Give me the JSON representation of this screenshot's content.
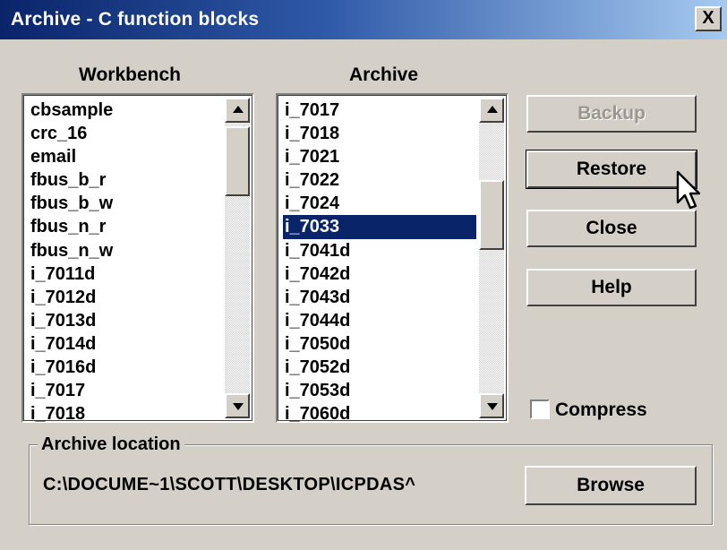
{
  "window": {
    "title": "Archive - C function blocks",
    "close_label": "X"
  },
  "workbench": {
    "heading": "Workbench",
    "items": [
      "cbsample",
      "crc_16",
      "email",
      "fbus_b_r",
      "fbus_b_w",
      "fbus_n_r",
      "fbus_n_w",
      "i_7011d",
      "i_7012d",
      "i_7013d",
      "i_7014d",
      "i_7016d",
      "i_7017",
      "i_7018"
    ]
  },
  "archive": {
    "heading": "Archive",
    "items": [
      "i_7017",
      "i_7018",
      "i_7021",
      "i_7022",
      "i_7024",
      "i_7033",
      "i_7041d",
      "i_7042d",
      "i_7043d",
      "i_7044d",
      "i_7050d",
      "i_7052d",
      "i_7053d",
      "i_7060d"
    ],
    "selected": "i_7033"
  },
  "buttons": {
    "backup": "Backup",
    "restore": "Restore",
    "close": "Close",
    "help": "Help",
    "browse": "Browse"
  },
  "compress": {
    "label": "Compress",
    "checked": false
  },
  "location": {
    "label": "Archive location",
    "path": "C:\\DOCUME~1\\SCOTT\\DESKTOP\\ICPDAS^"
  },
  "colors": {
    "title_start": "#0a246a",
    "title_end": "#a6caf0",
    "selection": "#0a246a",
    "face": "#d4d0c8"
  },
  "icons": {
    "pointer": "arrow-cursor-icon"
  }
}
